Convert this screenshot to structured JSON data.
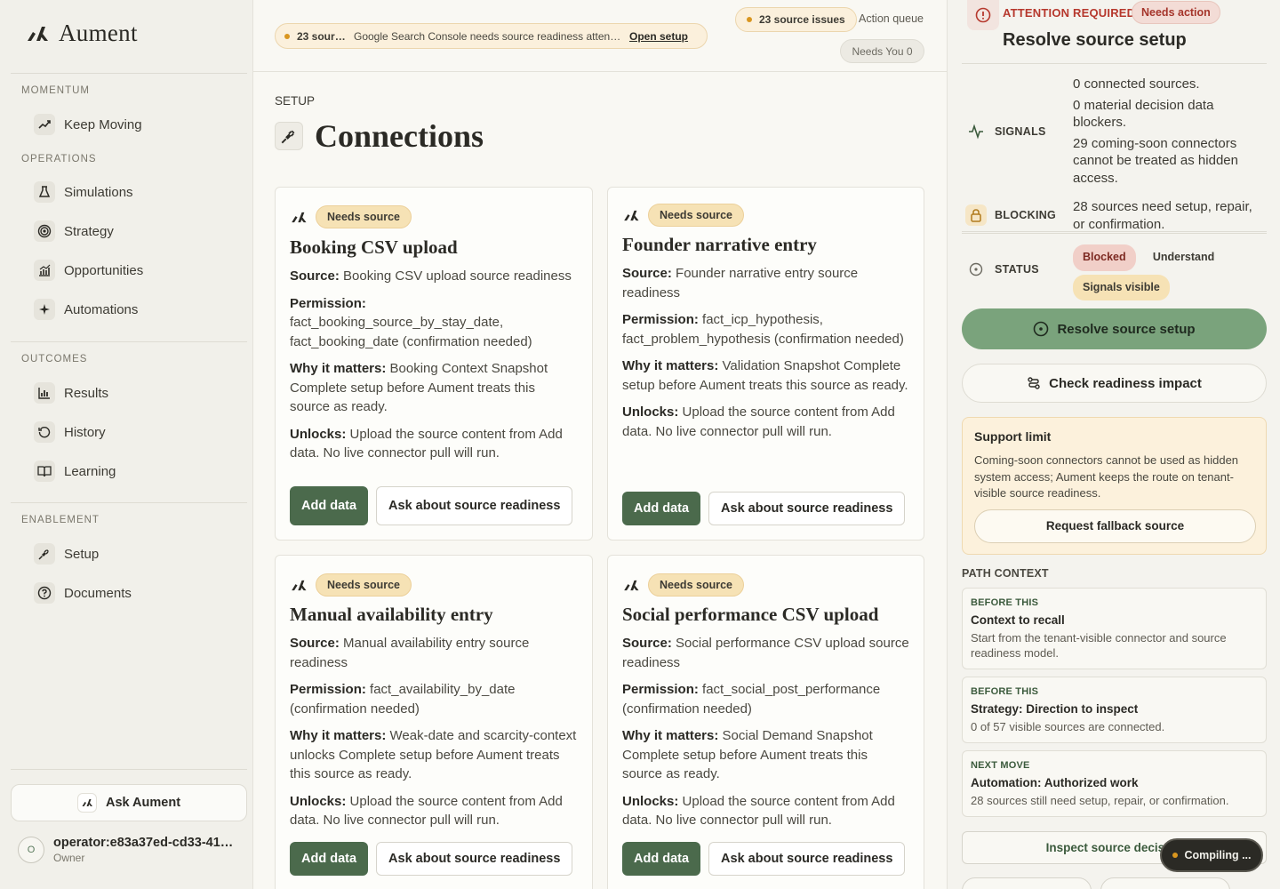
{
  "brand": {
    "name": "Aument"
  },
  "sidebar": {
    "sections": [
      {
        "label": "MOMENTUM"
      },
      {
        "label": "OPERATIONS"
      },
      {
        "label": "OUTCOMES"
      },
      {
        "label": "ENABLEMENT"
      }
    ],
    "items": [
      {
        "label": "Keep Moving",
        "icon": "trend-up-icon"
      },
      {
        "label": "Simulations",
        "icon": "flask-icon"
      },
      {
        "label": "Strategy",
        "icon": "target-icon"
      },
      {
        "label": "Opportunities",
        "icon": "chart-growth-icon"
      },
      {
        "label": "Automations",
        "icon": "sparkle-icon"
      },
      {
        "label": "Results",
        "icon": "bar-chart-icon"
      },
      {
        "label": "History",
        "icon": "history-icon"
      },
      {
        "label": "Learning",
        "icon": "book-icon"
      },
      {
        "label": "Setup",
        "icon": "plug-icon"
      },
      {
        "label": "Documents",
        "icon": "help-icon"
      }
    ],
    "ask_label": "Ask Aument",
    "operator": {
      "avatar": "O",
      "name": "operator:e83a37ed-cd33-41…",
      "role": "Owner"
    }
  },
  "topbar": {
    "alert_count": "23 sourc…",
    "alert_message": "Google Search Console needs source readiness attenti…",
    "alert_link": "Open setup",
    "issues_label": "23 source issues",
    "queue_label": "Action queue",
    "needs_label": "Needs You 0"
  },
  "page": {
    "section": "SETUP",
    "title": "Connections"
  },
  "labels": {
    "source": "Source:",
    "permission": "Permission:",
    "why": "Why it matters:",
    "unlocks": "Unlocks:",
    "add_data": "Add data",
    "ask_readiness": "Ask about source readiness"
  },
  "cards": [
    {
      "badge": "Needs source",
      "title": "Booking CSV upload",
      "source": "Booking CSV upload source readiness",
      "permission": "fact_booking_source_by_stay_date, fact_booking_date (confirmation needed)",
      "why": "Booking Context Snapshot Complete setup before Aument treats this source as ready.",
      "unlocks": "Upload the source content from Add data. No live connector pull will run."
    },
    {
      "badge": "Needs source",
      "title": "Founder narrative entry",
      "source": "Founder narrative entry source readiness",
      "permission": "fact_icp_hypothesis, fact_problem_hypothesis (confirmation needed)",
      "why": "Validation Snapshot Complete setup before Aument treats this source as ready.",
      "unlocks": "Upload the source content from Add data. No live connector pull will run."
    },
    {
      "badge": "Needs source",
      "title": "Manual availability entry",
      "source": "Manual availability entry source readiness",
      "permission": "fact_availability_by_date (confirmation needed)",
      "why": "Weak-date and scarcity-context unlocks Complete setup before Aument treats this source as ready.",
      "unlocks": "Upload the source content from Add data. No live connector pull will run."
    },
    {
      "badge": "Needs source",
      "title": "Social performance CSV upload",
      "source": "Social performance CSV upload source readiness",
      "permission": "fact_social_post_performance (confirmation needed)",
      "why": "Social Demand Snapshot Complete setup before Aument treats this source as ready.",
      "unlocks": "Upload the source content from Add data. No live connector pull will run."
    }
  ],
  "panel": {
    "attention": "ATTENTION REQUIRED",
    "needs_action": "Needs action",
    "title": "Resolve source setup",
    "signals_label": "SIGNALS",
    "signals": [
      "0 connected sources.",
      "0 material decision data blockers.",
      "29 coming-soon connectors cannot be treated as hidden access."
    ],
    "blocking_label": "BLOCKING",
    "blocking_text": "28 sources need setup, repair, or confirmation.",
    "status_label": "STATUS",
    "status_pills": [
      "Blocked",
      "Understand",
      "Signals visible"
    ],
    "resolve_label": "Resolve source setup",
    "check_label": "Check readiness impact",
    "support_title": "Support limit",
    "support_text": "Coming-soon connectors cannot be used as hidden system access; Aument keeps the route on tenant-visible source readiness.",
    "fallback_label": "Request fallback source",
    "path_label": "PATH CONTEXT",
    "path": [
      {
        "kicker": "BEFORE THIS",
        "title": "Context to recall",
        "text": "Start from the tenant-visible connector and source readiness model."
      },
      {
        "kicker": "BEFORE THIS",
        "title": "Strategy: Direction to inspect",
        "text": "0 of 57 visible sources are connected."
      },
      {
        "kicker": "NEXT MOVE",
        "title": "Automation: Authorized work",
        "text": "28 sources still need setup, repair, or confirmation."
      }
    ],
    "inspect_label": "Inspect source decision"
  },
  "toast": {
    "label": "Compiling ..."
  },
  "colors": {
    "accent": "#4b6a4c",
    "warning": "#d9961f",
    "danger": "#b6382d"
  }
}
